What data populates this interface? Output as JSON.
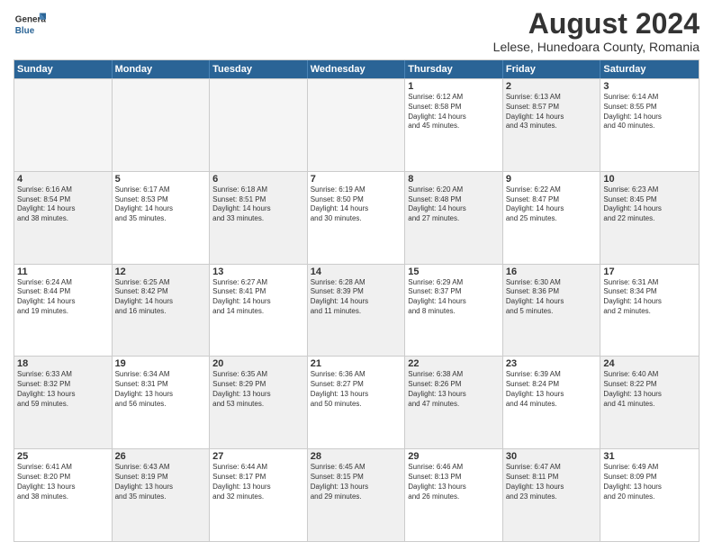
{
  "logo": {
    "general": "General",
    "blue": "Blue"
  },
  "title": "August 2024",
  "subtitle": "Lelese, Hunedoara County, Romania",
  "days": [
    "Sunday",
    "Monday",
    "Tuesday",
    "Wednesday",
    "Thursday",
    "Friday",
    "Saturday"
  ],
  "weeks": [
    [
      {
        "day": "",
        "detail": "",
        "empty": true
      },
      {
        "day": "",
        "detail": "",
        "empty": true
      },
      {
        "day": "",
        "detail": "",
        "empty": true
      },
      {
        "day": "",
        "detail": "",
        "empty": true
      },
      {
        "day": "1",
        "detail": "Sunrise: 6:12 AM\nSunset: 8:58 PM\nDaylight: 14 hours\nand 45 minutes.",
        "shaded": false
      },
      {
        "day": "2",
        "detail": "Sunrise: 6:13 AM\nSunset: 8:57 PM\nDaylight: 14 hours\nand 43 minutes.",
        "shaded": true
      },
      {
        "day": "3",
        "detail": "Sunrise: 6:14 AM\nSunset: 8:55 PM\nDaylight: 14 hours\nand 40 minutes.",
        "shaded": false
      }
    ],
    [
      {
        "day": "4",
        "detail": "Sunrise: 6:16 AM\nSunset: 8:54 PM\nDaylight: 14 hours\nand 38 minutes.",
        "shaded": true
      },
      {
        "day": "5",
        "detail": "Sunrise: 6:17 AM\nSunset: 8:53 PM\nDaylight: 14 hours\nand 35 minutes.",
        "shaded": false
      },
      {
        "day": "6",
        "detail": "Sunrise: 6:18 AM\nSunset: 8:51 PM\nDaylight: 14 hours\nand 33 minutes.",
        "shaded": true
      },
      {
        "day": "7",
        "detail": "Sunrise: 6:19 AM\nSunset: 8:50 PM\nDaylight: 14 hours\nand 30 minutes.",
        "shaded": false
      },
      {
        "day": "8",
        "detail": "Sunrise: 6:20 AM\nSunset: 8:48 PM\nDaylight: 14 hours\nand 27 minutes.",
        "shaded": true
      },
      {
        "day": "9",
        "detail": "Sunrise: 6:22 AM\nSunset: 8:47 PM\nDaylight: 14 hours\nand 25 minutes.",
        "shaded": false
      },
      {
        "day": "10",
        "detail": "Sunrise: 6:23 AM\nSunset: 8:45 PM\nDaylight: 14 hours\nand 22 minutes.",
        "shaded": true
      }
    ],
    [
      {
        "day": "11",
        "detail": "Sunrise: 6:24 AM\nSunset: 8:44 PM\nDaylight: 14 hours\nand 19 minutes.",
        "shaded": false
      },
      {
        "day": "12",
        "detail": "Sunrise: 6:25 AM\nSunset: 8:42 PM\nDaylight: 14 hours\nand 16 minutes.",
        "shaded": true
      },
      {
        "day": "13",
        "detail": "Sunrise: 6:27 AM\nSunset: 8:41 PM\nDaylight: 14 hours\nand 14 minutes.",
        "shaded": false
      },
      {
        "day": "14",
        "detail": "Sunrise: 6:28 AM\nSunset: 8:39 PM\nDaylight: 14 hours\nand 11 minutes.",
        "shaded": true
      },
      {
        "day": "15",
        "detail": "Sunrise: 6:29 AM\nSunset: 8:37 PM\nDaylight: 14 hours\nand 8 minutes.",
        "shaded": false
      },
      {
        "day": "16",
        "detail": "Sunrise: 6:30 AM\nSunset: 8:36 PM\nDaylight: 14 hours\nand 5 minutes.",
        "shaded": true
      },
      {
        "day": "17",
        "detail": "Sunrise: 6:31 AM\nSunset: 8:34 PM\nDaylight: 14 hours\nand 2 minutes.",
        "shaded": false
      }
    ],
    [
      {
        "day": "18",
        "detail": "Sunrise: 6:33 AM\nSunset: 8:32 PM\nDaylight: 13 hours\nand 59 minutes.",
        "shaded": true
      },
      {
        "day": "19",
        "detail": "Sunrise: 6:34 AM\nSunset: 8:31 PM\nDaylight: 13 hours\nand 56 minutes.",
        "shaded": false
      },
      {
        "day": "20",
        "detail": "Sunrise: 6:35 AM\nSunset: 8:29 PM\nDaylight: 13 hours\nand 53 minutes.",
        "shaded": true
      },
      {
        "day": "21",
        "detail": "Sunrise: 6:36 AM\nSunset: 8:27 PM\nDaylight: 13 hours\nand 50 minutes.",
        "shaded": false
      },
      {
        "day": "22",
        "detail": "Sunrise: 6:38 AM\nSunset: 8:26 PM\nDaylight: 13 hours\nand 47 minutes.",
        "shaded": true
      },
      {
        "day": "23",
        "detail": "Sunrise: 6:39 AM\nSunset: 8:24 PM\nDaylight: 13 hours\nand 44 minutes.",
        "shaded": false
      },
      {
        "day": "24",
        "detail": "Sunrise: 6:40 AM\nSunset: 8:22 PM\nDaylight: 13 hours\nand 41 minutes.",
        "shaded": true
      }
    ],
    [
      {
        "day": "25",
        "detail": "Sunrise: 6:41 AM\nSunset: 8:20 PM\nDaylight: 13 hours\nand 38 minutes.",
        "shaded": false
      },
      {
        "day": "26",
        "detail": "Sunrise: 6:43 AM\nSunset: 8:19 PM\nDaylight: 13 hours\nand 35 minutes.",
        "shaded": true
      },
      {
        "day": "27",
        "detail": "Sunrise: 6:44 AM\nSunset: 8:17 PM\nDaylight: 13 hours\nand 32 minutes.",
        "shaded": false
      },
      {
        "day": "28",
        "detail": "Sunrise: 6:45 AM\nSunset: 8:15 PM\nDaylight: 13 hours\nand 29 minutes.",
        "shaded": true
      },
      {
        "day": "29",
        "detail": "Sunrise: 6:46 AM\nSunset: 8:13 PM\nDaylight: 13 hours\nand 26 minutes.",
        "shaded": false
      },
      {
        "day": "30",
        "detail": "Sunrise: 6:47 AM\nSunset: 8:11 PM\nDaylight: 13 hours\nand 23 minutes.",
        "shaded": true
      },
      {
        "day": "31",
        "detail": "Sunrise: 6:49 AM\nSunset: 8:09 PM\nDaylight: 13 hours\nand 20 minutes.",
        "shaded": false
      }
    ]
  ]
}
